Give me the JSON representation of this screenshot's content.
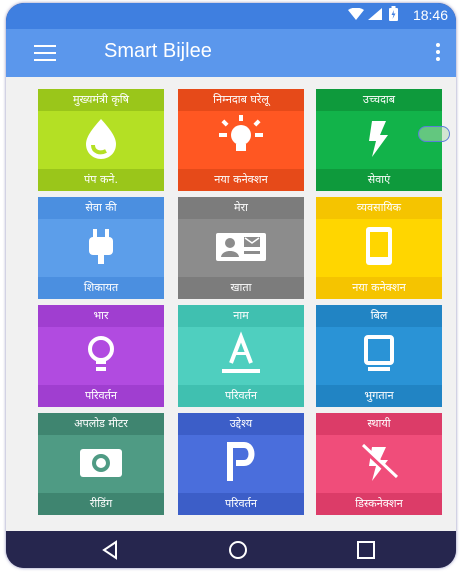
{
  "status_bar": {
    "time": "18:46"
  },
  "app": {
    "title": "Smart Bijlee"
  },
  "tiles": [
    {
      "top": "मुख्यमंत्री कृषि",
      "bottom": "पंप कने.",
      "icon": "drop-icon"
    },
    {
      "top": "निम्नदाब घरेलू",
      "bottom": "नया कनेक्शन",
      "icon": "bulb-glow-icon"
    },
    {
      "top": "उच्चदाब",
      "bottom": "सेवाएं",
      "icon": "flash-icon"
    },
    {
      "top": "सेवा की",
      "bottom": "शिकायत",
      "icon": "plug-icon"
    },
    {
      "top": "मेरा",
      "bottom": "खाता",
      "icon": "contact-card-icon"
    },
    {
      "top": "व्यवसायिक",
      "bottom": "नया कनेक्शन",
      "icon": "tablet-icon"
    },
    {
      "top": "भार",
      "bottom": "परिवर्तन",
      "icon": "lightbulb-outline-icon"
    },
    {
      "top": "नाम",
      "bottom": "परिवर्तन",
      "icon": "text-format-icon"
    },
    {
      "top": "बिल",
      "bottom": "भुगतान",
      "icon": "monitor-icon"
    },
    {
      "top": "अपलोड मीटर",
      "bottom": "रीडिंग",
      "icon": "camera-icon"
    },
    {
      "top": "उद्देश्य",
      "bottom": "परिवर्तन",
      "icon": "parking-p-icon"
    },
    {
      "top": "स्थायी",
      "bottom": "डिस्कनेक्शन",
      "icon": "flash-off-icon"
    }
  ],
  "colors": {
    "status_bar": "#3f7fe0",
    "app_bar": "#5b97ec",
    "nav_bar": "#26264e"
  }
}
